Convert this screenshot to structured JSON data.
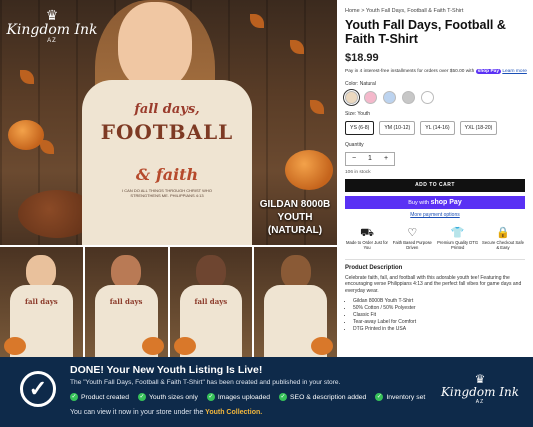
{
  "logo": {
    "brand": "Kingdom Ink",
    "sub": "AZ",
    "crown": "♛"
  },
  "hero": {
    "shirt_lines": [
      "fall days,",
      "FOOTBALL",
      "& faith"
    ],
    "verse": "I CAN DO ALL THINGS THROUGH CHRIST WHO STRENGTHENS ME. PHILIPPIANS 4:13",
    "gildan_lines": [
      "GILDAN 8000B",
      "YOUTH",
      "(NATURAL)"
    ]
  },
  "thumbs": [
    {
      "text": "fall days"
    },
    {
      "text": "fall days"
    },
    {
      "text": "fall days"
    },
    {
      "text": ""
    }
  ],
  "product": {
    "breadcrumb": "Home  >  Youth Fall Days, Football & Faith T-Shirt",
    "title": "Youth Fall Days, Football & Faith T-Shirt",
    "price": "$18.99",
    "pay_text": "Pay in 4 interest-free installments for orders over $50.00 with",
    "shop_pay": "shop Pay",
    "learn_more": "Learn more",
    "color_label": "Color: Natural",
    "colors": [
      "#ecd9c0",
      "#f4b8cb",
      "#bcd3ef",
      "#c7c7c7",
      "#ffffff"
    ],
    "size_label": "Size: Youth",
    "sizes": [
      "YS (6-8)",
      "YM (10-12)",
      "YL (14-16)",
      "YXL (18-20)"
    ],
    "quantity_label": "Quantity",
    "qty_minus": "−",
    "qty_value": "1",
    "qty_plus": "+",
    "stock": "106 in stock",
    "add_to_cart": "ADD TO CART",
    "buy_with": "Buy with",
    "buy_shop": "shop Pay",
    "more_payment": "More payment options",
    "features": [
      {
        "icon": "truck-icon",
        "glyph": "⛟",
        "label": "Made to Order Just for You"
      },
      {
        "icon": "heart-icon",
        "glyph": "♡",
        "label": "Faith Based Purpose Driven"
      },
      {
        "icon": "shirt-icon",
        "glyph": "👕",
        "label": "Premium Quality DTG Printed"
      },
      {
        "icon": "lock-icon",
        "glyph": "🔒",
        "label": "Secure Checkout Safe & Easy"
      }
    ],
    "desc_heading": "Product Description",
    "desc": "Celebrate faith, fall, and football with this adorable youth tee! Featuring the encouraging verse Philippians 4:13 and the perfect fall vibes for game days and everyday wear.",
    "bullets": [
      "Gildan 8000B Youth T-Shirt",
      "50% Cotton / 50% Polyester",
      "Classic Fit",
      "Tear-away Label for Comfort",
      "DTG Printed in the USA"
    ]
  },
  "banner": {
    "headline": "DONE! Your New Youth Listing Is Live!",
    "subline": "The \"Youth Fall Days, Football & Faith T-Shirt\" has been created and published in your store.",
    "tags": [
      "Product created",
      "Youth sizes only",
      "Images uploaded",
      "SEO & description added",
      "Inventory set"
    ],
    "footer_prefix": "You can view it now in your store under the",
    "footer_link": "Youth Collection."
  }
}
